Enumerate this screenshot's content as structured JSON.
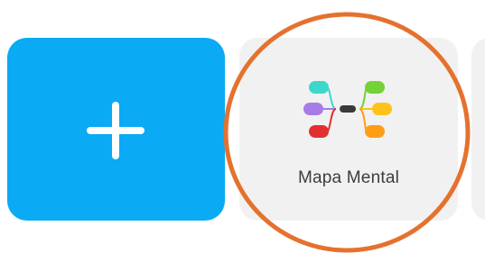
{
  "new_tile": {
    "icon": "plus-icon",
    "color": "#0aaaf5"
  },
  "template_tile": {
    "icon": "mind-map-icon",
    "label": "Mapa Mental",
    "background": "#f1f1f1"
  },
  "highlight": {
    "color": "#e4722f"
  }
}
